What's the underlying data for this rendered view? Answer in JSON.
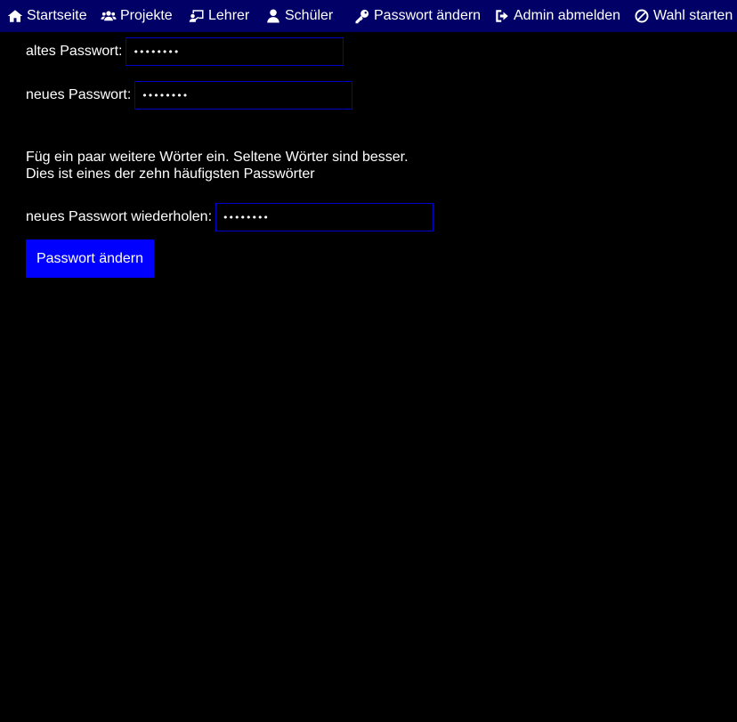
{
  "nav": {
    "items": [
      {
        "label": "Startseite",
        "icon": "home-icon"
      },
      {
        "label": "Projekte",
        "icon": "users-icon"
      },
      {
        "label": "Lehrer",
        "icon": "chalkboard-teacher-icon"
      },
      {
        "label": "Schüler",
        "icon": "user-icon"
      },
      {
        "label": "Passwort ändern",
        "icon": "key-icon"
      },
      {
        "label": "Admin abmelden",
        "icon": "sign-out-icon"
      },
      {
        "label": "Wahl starten",
        "icon": "ban-icon"
      }
    ]
  },
  "form": {
    "old_password": {
      "label": "altes Passwort:",
      "value": "••••••••"
    },
    "new_password": {
      "label": "neues Passwort:",
      "value": "••••••••"
    },
    "feedback": {
      "line1": "Füg ein paar weitere Wörter ein. Seltene Wörter sind besser.",
      "line2": "Dies ist eines der zehn häufigsten Passwörter"
    },
    "repeat_password": {
      "label": "neues Passwort wiederholen:",
      "value": "••••••••"
    },
    "submit_label": "Passwort ändern"
  },
  "colors": {
    "navbar_bg": "#000066",
    "page_bg": "#000000",
    "input_border": "#0000cc",
    "button_bg": "#0000ff",
    "text": "#ffffff"
  }
}
